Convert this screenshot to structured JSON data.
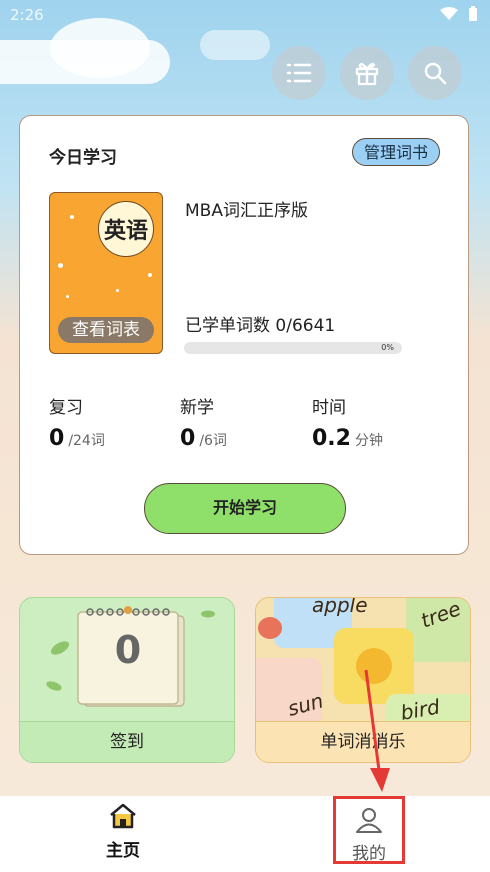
{
  "status_bar": {
    "time": "2:26"
  },
  "top_actions": [
    {
      "icon": "list-icon"
    },
    {
      "icon": "gift-icon"
    },
    {
      "icon": "search-icon"
    }
  ],
  "today": {
    "title": "今日学习",
    "manage_label": "管理词书",
    "book": {
      "cover_text": "英语",
      "view_label": "查看词表",
      "name": "MBA词汇正序版"
    },
    "learned_text": "已学单词数 0/6641",
    "progress_pct": "0%",
    "progress_value": 0,
    "stats": [
      {
        "label": "复习",
        "value": "0",
        "unit": "/24词"
      },
      {
        "label": "新学",
        "value": "0",
        "unit": "/6词"
      },
      {
        "label": "时间",
        "value": "0.2",
        "unit": "分钟"
      }
    ],
    "start_label": "开始学习"
  },
  "tiles": {
    "checkin": {
      "label": "签到",
      "count": "0"
    },
    "game": {
      "label": "单词消消乐",
      "words": [
        "apple",
        "tree",
        "sun",
        "bird"
      ]
    }
  },
  "nav": {
    "home": {
      "label": "主页"
    },
    "mine": {
      "label": "我的"
    }
  },
  "colors": {
    "accent_green": "#8fe06a",
    "manage_blue": "#9bd0f4",
    "book_orange": "#f8a531",
    "highlight_red": "#e53935"
  }
}
